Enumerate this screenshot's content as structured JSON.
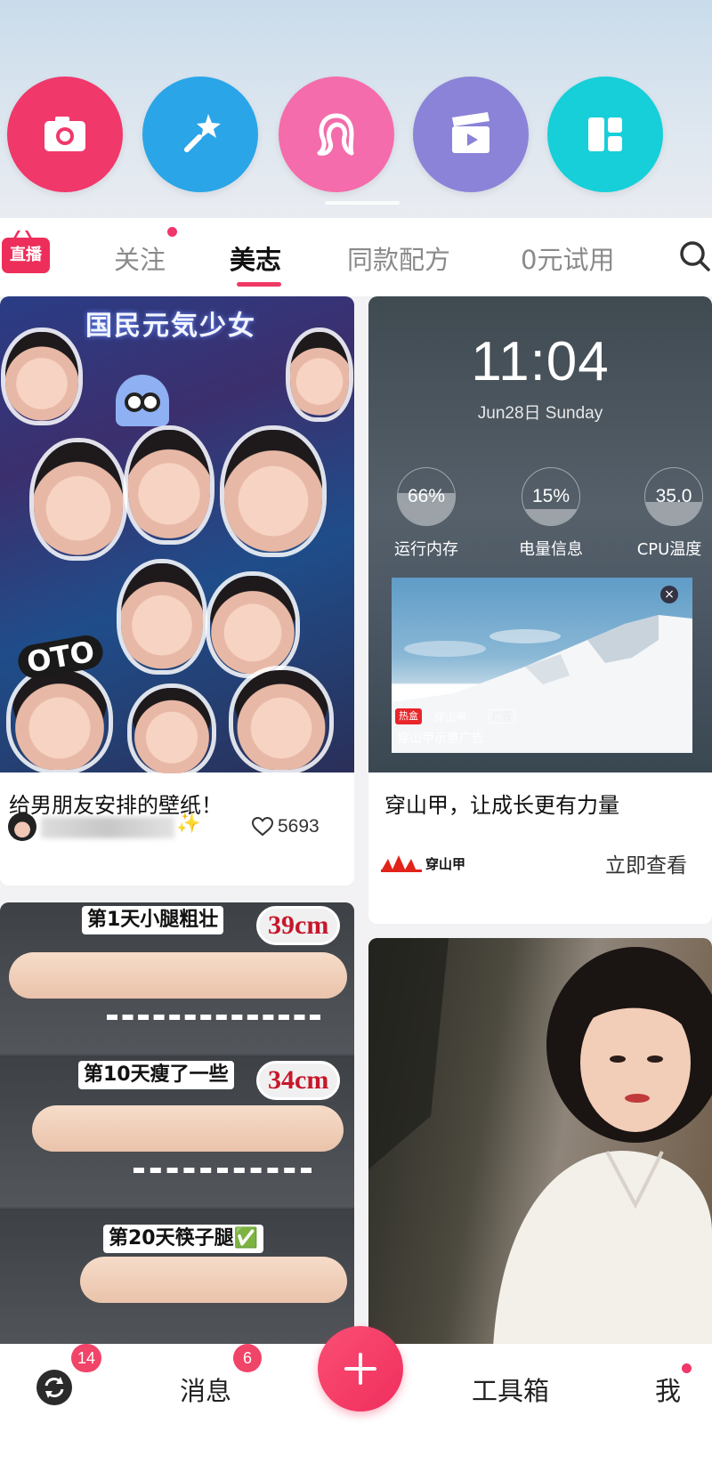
{
  "quick_actions": [
    {
      "id": "camera",
      "icon": "camera-icon",
      "color": "#f0386b"
    },
    {
      "id": "magic-wand",
      "icon": "magic-wand-icon",
      "color": "#2aa5e8"
    },
    {
      "id": "hair",
      "icon": "hair-icon",
      "color": "#f46cab"
    },
    {
      "id": "video",
      "icon": "clapperboard-icon",
      "color": "#8a83d8"
    },
    {
      "id": "layout",
      "icon": "collage-layout-icon",
      "color": "#16cfd8"
    }
  ],
  "tabs": {
    "live_badge": "直播",
    "items": [
      "关注",
      "美志",
      "同款配方",
      "0元试用"
    ],
    "active_index": 1,
    "accent": "#ef3966"
  },
  "feed": {
    "card1": {
      "title": "给男朋友安排的壁纸！",
      "likes": "5693",
      "collage_title": "国民元気少女",
      "sticker": "OTO"
    },
    "card2": {
      "clock_time": "11:04",
      "clock_date": "Jun28日 Sunday",
      "gauges": [
        {
          "value": "66%",
          "label": "运行内存",
          "fill": 0.66
        },
        {
          "value": "15%",
          "label": "电量信息",
          "fill": 0.15
        },
        {
          "value": "35.0",
          "label": "CPU温度",
          "fill": 0.35
        }
      ],
      "hot_badge": "热盒",
      "ad_brand_small": "穿山甲",
      "ad_tag": "广告",
      "ad_caption": "穿山甲示意广告",
      "title": "穿山甲，让成长更有力量",
      "brand": "穿山甲",
      "cta": "立即查看"
    },
    "card3": {
      "labels": [
        "第1天小腿粗壮",
        "第10天瘦了一些",
        "第20天筷子腿✅"
      ],
      "measures": [
        "39cm",
        "34cm"
      ]
    }
  },
  "bottom_nav": {
    "refresh_badge": "14",
    "messages": "消息",
    "messages_badge": "6",
    "toolbox": "工具箱",
    "me": "我"
  }
}
